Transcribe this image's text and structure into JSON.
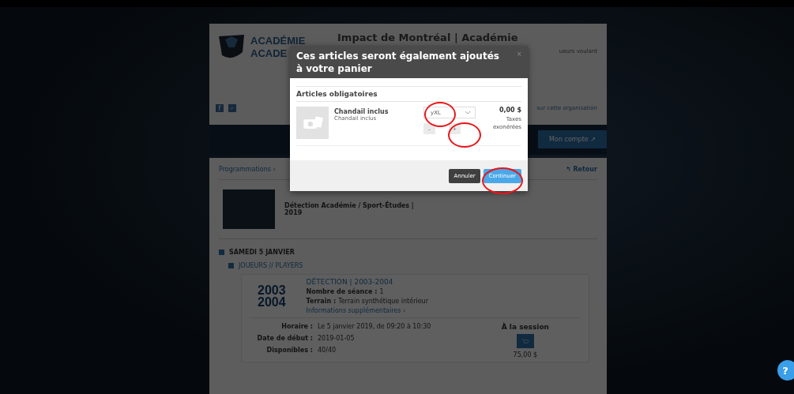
{
  "header": {
    "logo_line_1": "ACADÉMIE",
    "logo_line_2": "ACADE",
    "title": "Impact de Montréal | Académie",
    "description_fragment": "ueurs voulant",
    "link_fragment": "sur cette organisation"
  },
  "account_button": "Mon compte ↗",
  "social_icons": [
    "f"
  ],
  "help": "?",
  "nav": {
    "breadcrumb": "Programmations ›",
    "back": "↰ Retour"
  },
  "event": {
    "title": "Détection Académie / Sport-Études | 2019"
  },
  "day": "SAMEDI 5 JANVIER",
  "group": "JOUEURS // PLAYERS",
  "session": {
    "badge_lines": [
      "2003",
      "2004"
    ],
    "title": "DÉTECTION | 2003-2004",
    "details": [
      {
        "label": "Nombre de séance :",
        "value": "1"
      },
      {
        "label": "Terrain :",
        "value": "Terrain synthétique intérieur"
      }
    ],
    "more_link": "Informations supplémentaires ›",
    "facts": [
      {
        "label": "Horaire :",
        "value": "Le 5 janvier 2019, de 09:20 à 10:30"
      },
      {
        "label": "Date de début :",
        "value": "2019-01-05"
      },
      {
        "label": "Disponibles :",
        "value": "40/40"
      }
    ],
    "price_heading": "À la session",
    "price": "75,00 $"
  },
  "modal": {
    "title": "Ces articles seront également ajoutés à votre panier",
    "close": "×",
    "section": "Articles obligatoires",
    "items": [
      {
        "name": "Chandail inclus",
        "subtitle": "Chandail inclus",
        "size": "yXL",
        "minus": "-",
        "plus": "+",
        "price": "0,00 $",
        "tax_note": "Taxes exonérées"
      }
    ],
    "buttons": [
      {
        "label": "Annuler",
        "kind": "secondary"
      },
      {
        "label": "Continuer",
        "kind": "primary"
      }
    ]
  }
}
